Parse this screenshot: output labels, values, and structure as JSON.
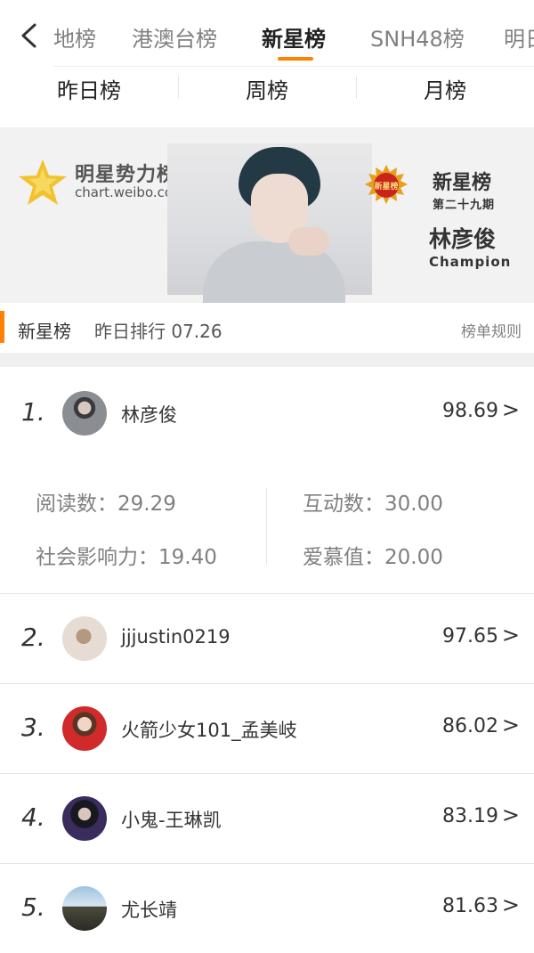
{
  "nav": {
    "tabs": [
      "地榜",
      "港澳台榜",
      "新星榜",
      "SNH48榜",
      "明日"
    ],
    "active_tab": "新星榜",
    "accent": "#ff8200"
  },
  "subtabs": [
    "昨日榜",
    "周榜",
    "月榜"
  ],
  "banner": {
    "brand": "明星势力榜",
    "url": "chart.weibo.com",
    "badge": "新星榜",
    "title": "新星榜",
    "issue": "第二十九期",
    "champion_name": "林彦俊",
    "champion_label": "Champion"
  },
  "section": {
    "title": "新星榜",
    "subtitle": "昨日排行 07.26",
    "rules_link": "榜单规则"
  },
  "list": [
    {
      "rank": "1.",
      "name": "林彦俊",
      "score": "98.69",
      "chevron": ">"
    },
    {
      "rank": "2.",
      "name": "jjjustin0219",
      "score": "97.65",
      "chevron": ">"
    },
    {
      "rank": "3.",
      "name": "火箭少女101_孟美岐",
      "score": "86.02",
      "chevron": ">"
    },
    {
      "rank": "4.",
      "name": "小鬼-王琳凯",
      "score": "83.19",
      "chevron": ">"
    },
    {
      "rank": "5.",
      "name": "尤长靖",
      "score": "81.63",
      "chevron": ">"
    }
  ],
  "detail": {
    "read": "阅读数：29.29",
    "interaction": "互动数：30.00",
    "influence": "社会影响力：19.40",
    "love": "爱慕值：20.00"
  }
}
